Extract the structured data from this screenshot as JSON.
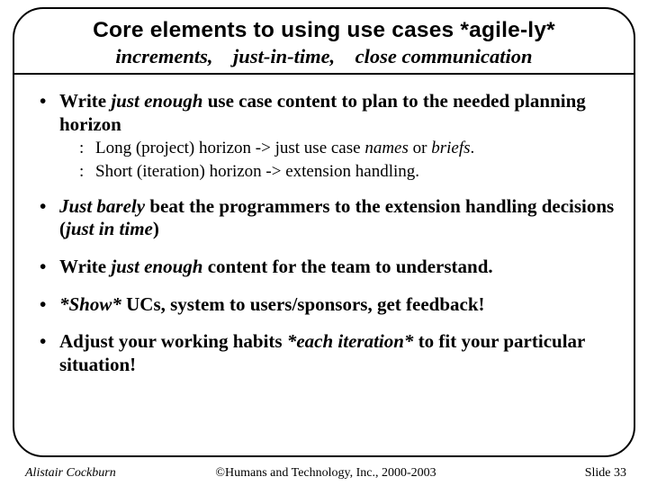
{
  "title": "Core elements to using use cases *agile-ly*",
  "subtitle": "increments,    just-in-time,    close communication",
  "bullets": {
    "b1a": "Write ",
    "b1b": "just enough",
    "b1c": " use case content to plan to the needed planning horizon",
    "s1a": "Long (project) horizon -> just use case ",
    "s1b": "names",
    "s1c": " or ",
    "s1d": "briefs",
    "s1e": ".",
    "s2": "Short (iteration) horizon -> extension handling.",
    "b2a": "Just barely",
    "b2b": " beat the programmers to the extension handling decisions (",
    "b2c": "just in time",
    "b2d": ")",
    "b3a": "Write ",
    "b3b": "just enough",
    "b3c": " content for the team to understand.",
    "b4a": "*Show*",
    "b4b": " UCs,  system to users/sponsors, get feedback!",
    "b5a": "Adjust your working habits ",
    "b5b": "*each iteration*",
    "b5c": " to fit your particular situation!"
  },
  "footer": {
    "author": "Alistair Cockburn",
    "copyright": "©Humans and Technology, Inc., 2000-2003",
    "slide": "Slide 33"
  }
}
